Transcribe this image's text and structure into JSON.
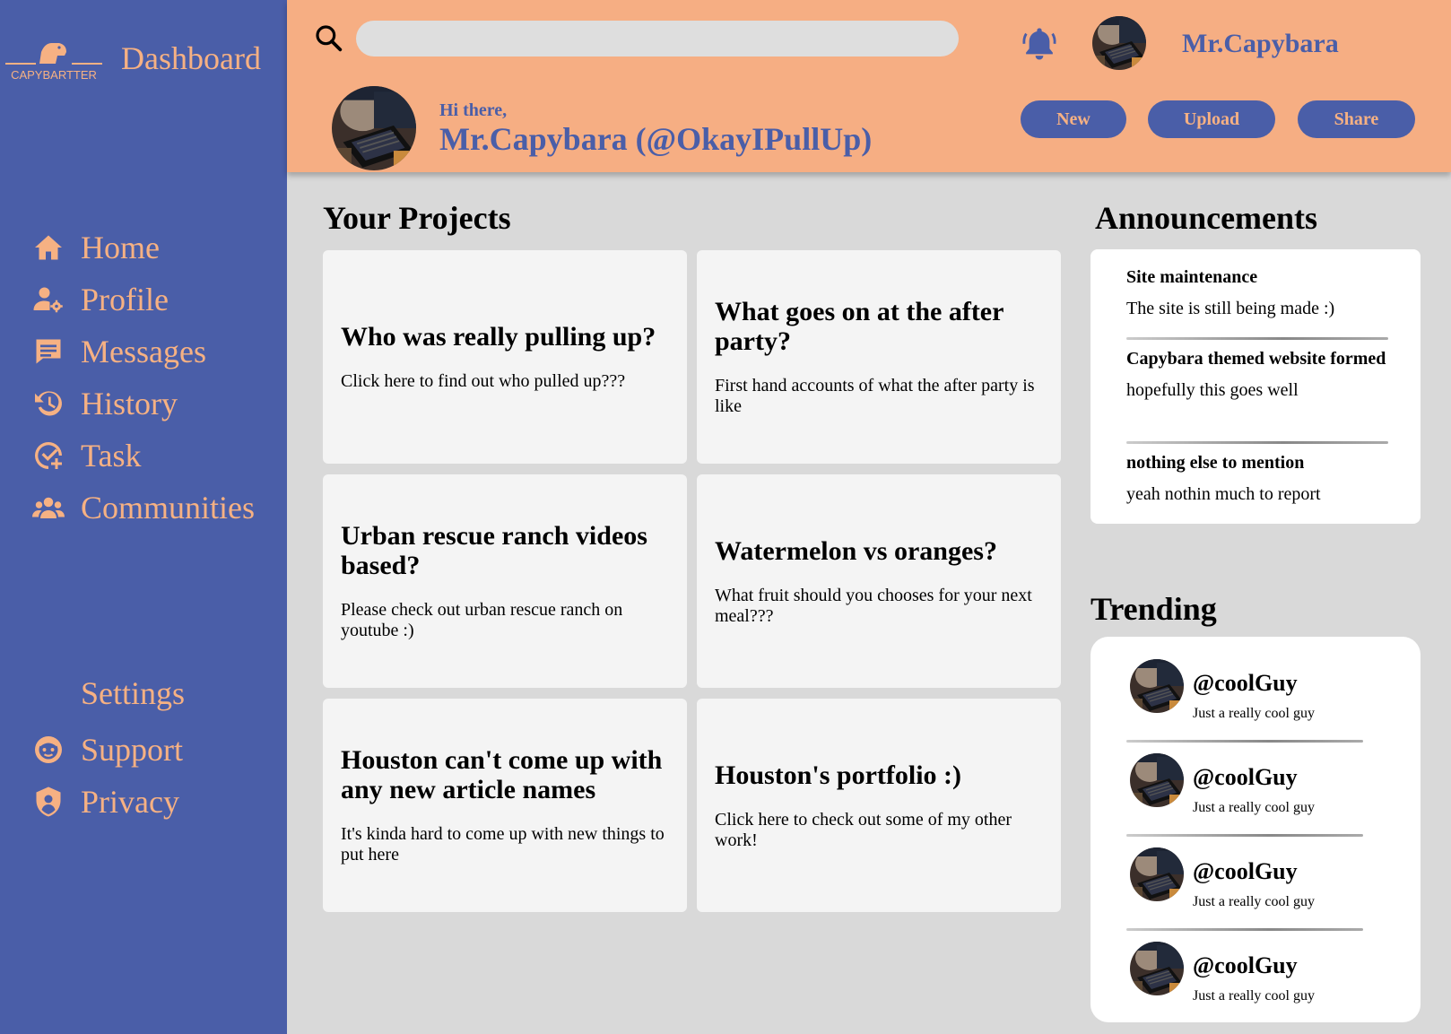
{
  "brand": {
    "logo_text": "CAPYBARTTER",
    "title": "Dashboard"
  },
  "nav": {
    "items": [
      {
        "label": "Home",
        "icon": "home-icon"
      },
      {
        "label": "Profile",
        "icon": "user-gear-icon"
      },
      {
        "label": "Messages",
        "icon": "message-icon"
      },
      {
        "label": "History",
        "icon": "history-icon"
      },
      {
        "label": "Task",
        "icon": "task-icon"
      },
      {
        "label": "Communities",
        "icon": "users-icon"
      }
    ],
    "settings_label": "Settings",
    "bottom_items": [
      {
        "label": "Support",
        "icon": "support-icon"
      },
      {
        "label": "Privacy",
        "icon": "shield-icon"
      }
    ]
  },
  "header": {
    "search_placeholder": "",
    "username": "Mr.Capybara",
    "greeting": "Hi there,",
    "greeting_name": "Mr.Capybara (@OkayIPullUp)",
    "buttons": {
      "new": "New",
      "upload": "Upload",
      "share": "Share"
    }
  },
  "projects": {
    "title": "Your Projects",
    "cards": [
      {
        "title": "Who was really pulling up?",
        "desc": "Click here to find out who pulled up???"
      },
      {
        "title": "What goes on at the after party?",
        "desc": "First hand accounts of what the after party is like"
      },
      {
        "title": "Urban rescue ranch videos based?",
        "desc": "Please check out urban rescue ranch on youtube :)"
      },
      {
        "title": "Watermelon vs oranges?",
        "desc": "What fruit should you chooses for your next meal???"
      },
      {
        "title": "Houston can't come up with any new article names",
        "desc": "It's kinda hard to come up with new things to put here"
      },
      {
        "title": "Houston's portfolio :)",
        "desc": "Click here to check out some of my other work!"
      }
    ]
  },
  "announcements": {
    "title": "Announcements",
    "items": [
      {
        "title": "Site maintenance",
        "body": "The site is still being made :)"
      },
      {
        "title": "Capybara themed website formed",
        "body": "hopefully this goes well"
      },
      {
        "title": "nothing else to mention",
        "body": "yeah nothin much to report"
      }
    ]
  },
  "trending": {
    "title": "Trending",
    "items": [
      {
        "handle": "@coolGuy",
        "bio": "Just a really cool guy"
      },
      {
        "handle": "@coolGuy",
        "bio": "Just a really cool guy"
      },
      {
        "handle": "@coolGuy",
        "bio": "Just a really cool guy"
      },
      {
        "handle": "@coolGuy",
        "bio": "Just a really cool guy"
      }
    ]
  },
  "colors": {
    "sidebar": "#4a5ea8",
    "accent": "#f6b183",
    "header": "#f6ae83",
    "background": "#d9d9d9"
  }
}
